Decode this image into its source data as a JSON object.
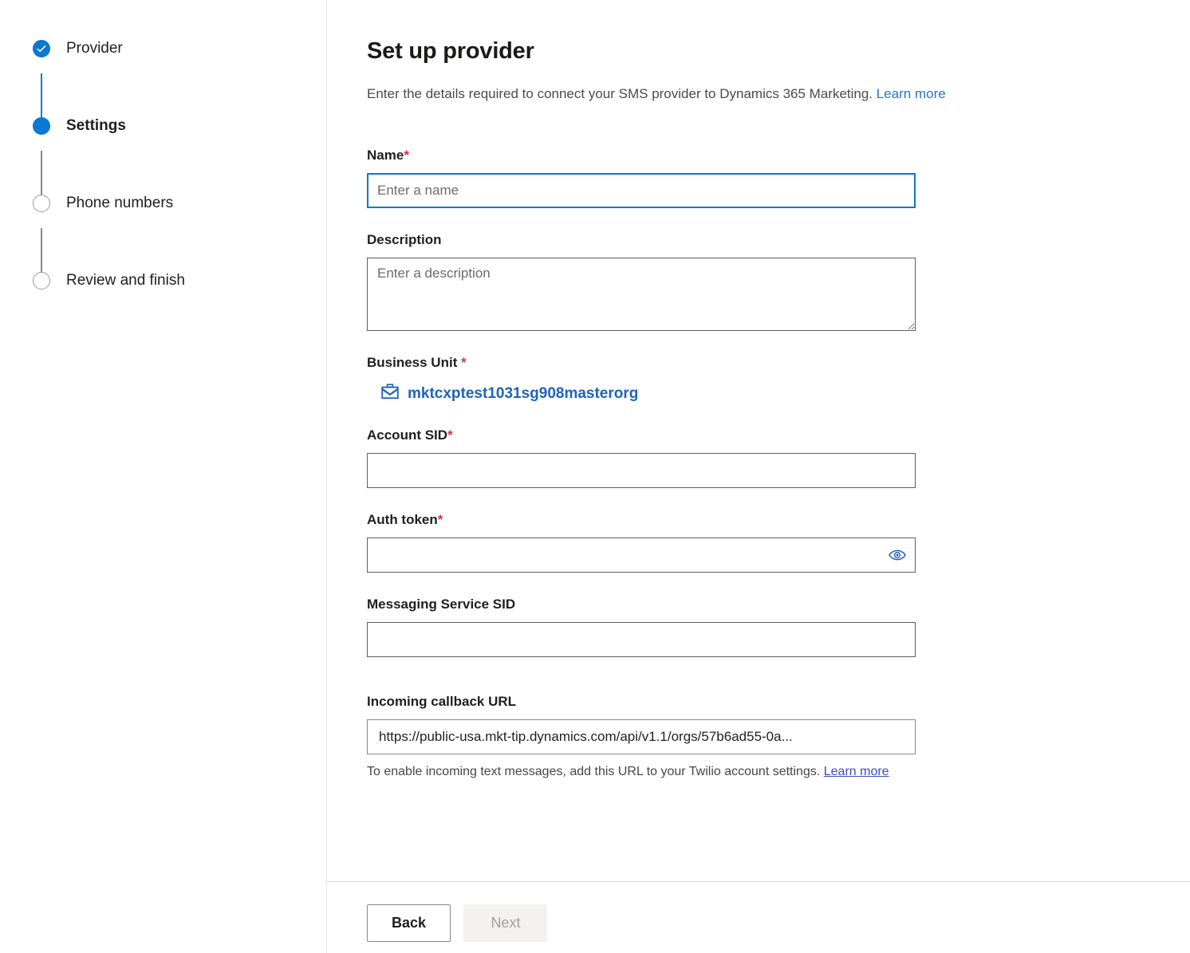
{
  "stepper": {
    "steps": [
      {
        "label": "Provider",
        "state": "done",
        "icon": "check-icon"
      },
      {
        "label": "Settings",
        "state": "current",
        "icon": "filled-circle-icon"
      },
      {
        "label": "Phone numbers",
        "state": "todo",
        "icon": "empty-circle-icon"
      },
      {
        "label": "Review and finish",
        "state": "todo",
        "icon": "empty-circle-icon"
      }
    ]
  },
  "header": {
    "title": "Set up provider",
    "subtitle": "Enter the details required to connect your SMS provider to Dynamics 365 Marketing.",
    "learn_more": "Learn more"
  },
  "form": {
    "name": {
      "label": "Name",
      "required_marker": "*",
      "placeholder": "Enter a name",
      "value": "",
      "focused": true
    },
    "description": {
      "label": "Description",
      "placeholder": "Enter a description",
      "value": ""
    },
    "business_unit": {
      "label": "Business Unit",
      "required_marker": "*",
      "value": "mktcxptest1031sg908masterorg",
      "icon": "briefcase-icon"
    },
    "account_sid": {
      "label": "Account SID",
      "required_marker": "*",
      "placeholder": "",
      "value": ""
    },
    "auth_token": {
      "label": "Auth token",
      "required_marker": "*",
      "placeholder": "",
      "value": "",
      "reveal_icon": "eye-icon"
    },
    "messaging_service_sid": {
      "label": "Messaging Service SID",
      "placeholder": "",
      "value": ""
    },
    "incoming_callback_url": {
      "label": "Incoming callback URL",
      "value": "https://public-usa.mkt-tip.dynamics.com/api/v1.1/orgs/57b6ad55-0a...",
      "helper_text": "To enable incoming text messages, add this URL to your Twilio account settings.",
      "helper_link": "Learn more"
    }
  },
  "footer": {
    "back_label": "Back",
    "next_label": "Next",
    "next_disabled": true
  },
  "colors": {
    "accent": "#0b78d1",
    "link": "#1f78d1",
    "link_visited": "#3b4cc0",
    "required": "#d13438",
    "business_unit_link": "#1f63b8",
    "border_input": "#605e5c",
    "divider": "#e8e8e8",
    "disabled_bg": "#f3f2f1",
    "disabled_text": "#a19f9d"
  }
}
